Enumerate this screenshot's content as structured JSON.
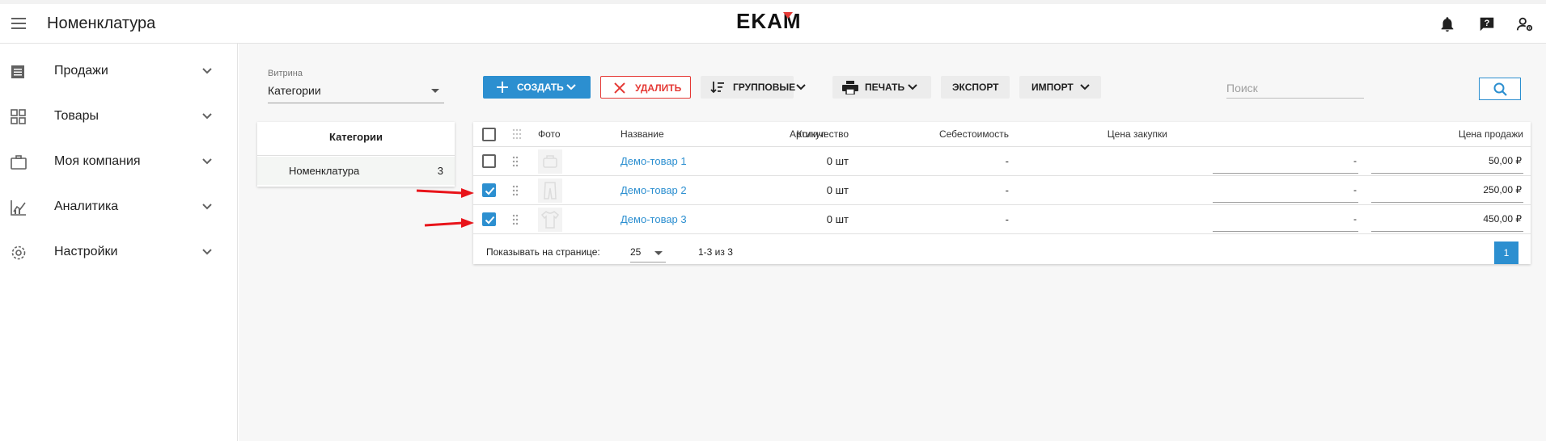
{
  "header": {
    "title": "Номенклатура",
    "logo_text": "EKAM"
  },
  "sidebar": {
    "items": [
      {
        "label": "Продажи",
        "icon": "list-icon"
      },
      {
        "label": "Товары",
        "icon": "grid-icon"
      },
      {
        "label": "Моя компания",
        "icon": "briefcase-icon"
      },
      {
        "label": "Аналитика",
        "icon": "analytics-icon"
      },
      {
        "label": "Настройки",
        "icon": "gear-icon"
      }
    ]
  },
  "vitrina": {
    "label": "Витрина",
    "value": "Категории"
  },
  "categories": {
    "header": "Категории",
    "items": [
      {
        "name": "Номенклатура",
        "count": "3"
      }
    ]
  },
  "toolbar": {
    "create": "СОЗДАТЬ",
    "delete": "УДАЛИТЬ",
    "group": "ГРУППОВЫЕ",
    "print": "ПЕЧАТЬ",
    "export": "ЭКСПОРТ",
    "import": "ИМПОРТ",
    "search_placeholder": "Поиск"
  },
  "table": {
    "columns": [
      "Фото",
      "Название",
      "Артикул",
      "Количество",
      "Себестоимость",
      "Цена закупки",
      "Цена продажи"
    ],
    "rows": [
      {
        "name": "Демо-товар 1",
        "sku": "",
        "qty": "0 шт",
        "cost": "-",
        "purchase": "-",
        "price": "50,00 ₽",
        "checked": false
      },
      {
        "name": "Демо-товар 2",
        "sku": "",
        "qty": "0 шт",
        "cost": "-",
        "purchase": "-",
        "price": "250,00 ₽",
        "checked": true
      },
      {
        "name": "Демо-товар 3",
        "sku": "",
        "qty": "0 шт",
        "cost": "-",
        "purchase": "-",
        "price": "450,00 ₽",
        "checked": true
      }
    ]
  },
  "pagination": {
    "per_page_label": "Показывать на странице:",
    "per_page": "25",
    "range": "1-3 из 3",
    "current_page": "1"
  },
  "colors": {
    "accent": "#2c8fd0",
    "danger": "#e53935",
    "annotation": "#e8141a"
  }
}
